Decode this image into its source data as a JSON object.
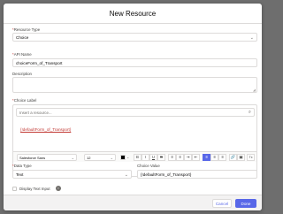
{
  "modal": {
    "title": "New Resource"
  },
  "resource_type": {
    "label": "Resource Type",
    "value": "Choice"
  },
  "api_name": {
    "label": "API Name",
    "value": "choiceForm_of_Transport"
  },
  "description": {
    "label": "Description",
    "value": ""
  },
  "choice_label": {
    "label": "Choice Label",
    "search_placeholder": "Insert a resource...",
    "content": "{!defaultForm_of_Transport}"
  },
  "toolbar": {
    "font": "Salesforce Sans",
    "size": "12",
    "text_color": "#000000",
    "buttons": [
      "B",
      "I",
      "U",
      "S",
      "≡",
      "≡",
      "⇥",
      "⇤",
      "≡",
      "≡",
      "≡",
      "🔗",
      "▣",
      "Tx"
    ]
  },
  "data_type": {
    "label": "Data Type",
    "value": "Text"
  },
  "choice_value": {
    "label": "Choice Value",
    "value": "{!defaultForm_of_Transport}"
  },
  "display_text_input": {
    "label": "Display Text Input"
  },
  "footer": {
    "cancel": "Cancel",
    "done": "Done"
  },
  "colors": {
    "brand": "#5867e8",
    "required": "#c23934",
    "overlay": "#6e6e6e"
  }
}
